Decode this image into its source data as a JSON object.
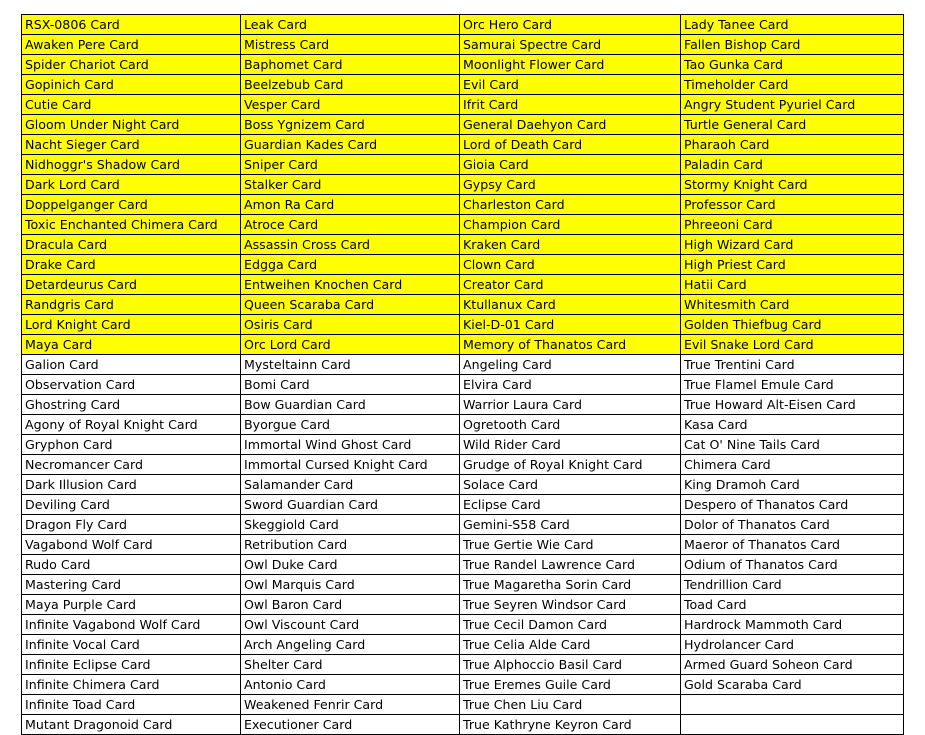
{
  "table": {
    "columns": 4,
    "highlight_color": "#ffff00",
    "plain_color": "#ffffff",
    "border_color": "#000000",
    "highlighted_row_count": 18,
    "rows": [
      {
        "highlighted": true,
        "cells": [
          "RSX-0806 Card",
          "Leak Card",
          "Orc Hero Card",
          "Lady Tanee Card"
        ]
      },
      {
        "highlighted": true,
        "cells": [
          "Awaken Pere Card",
          "Mistress Card",
          "Samurai Spectre Card",
          "Fallen Bishop Card"
        ]
      },
      {
        "highlighted": true,
        "cells": [
          "Spider Chariot Card",
          "Baphomet Card",
          "Moonlight Flower Card",
          "Tao Gunka Card"
        ]
      },
      {
        "highlighted": true,
        "cells": [
          "Gopinich Card",
          "Beelzebub Card",
          "Evil Card",
          "Timeholder Card"
        ]
      },
      {
        "highlighted": true,
        "cells": [
          "Cutie Card",
          "Vesper Card",
          "Ifrit Card",
          "Angry Student Pyuriel Card"
        ]
      },
      {
        "highlighted": true,
        "cells": [
          "Gloom Under Night Card",
          "Boss Ygnizem Card",
          "General Daehyon Card",
          "Turtle General Card"
        ]
      },
      {
        "highlighted": true,
        "cells": [
          "Nacht Sieger Card",
          "Guardian Kades Card",
          "Lord of Death Card",
          "Pharaoh Card"
        ]
      },
      {
        "highlighted": true,
        "cells": [
          "Nidhoggr's Shadow Card",
          "Sniper Card",
          "Gioia Card",
          "Paladin Card"
        ]
      },
      {
        "highlighted": true,
        "cells": [
          "Dark Lord Card",
          "Stalker Card",
          "Gypsy Card",
          "Stormy Knight Card"
        ]
      },
      {
        "highlighted": true,
        "cells": [
          "Doppelganger Card",
          "Amon Ra Card",
          "Charleston Card",
          "Professor Card"
        ]
      },
      {
        "highlighted": true,
        "cells": [
          "Toxic Enchanted Chimera Card",
          "Atroce Card",
          "Champion Card",
          "Phreeoni Card"
        ]
      },
      {
        "highlighted": true,
        "cells": [
          "Dracula Card",
          "Assassin Cross Card",
          "Kraken Card",
          "High Wizard Card"
        ]
      },
      {
        "highlighted": true,
        "cells": [
          "Drake Card",
          "Edgga Card",
          "Clown Card",
          "High Priest Card"
        ]
      },
      {
        "highlighted": true,
        "cells": [
          "Detardeurus Card",
          "Entweihen Knochen Card",
          "Creator Card",
          "Hatii Card"
        ]
      },
      {
        "highlighted": true,
        "cells": [
          "Randgris Card",
          "Queen Scaraba Card",
          "Ktullanux Card",
          "Whitesmith Card"
        ]
      },
      {
        "highlighted": true,
        "cells": [
          "Lord Knight Card",
          "Osiris Card",
          "Kiel-D-01 Card",
          "Golden Thiefbug Card"
        ]
      },
      {
        "highlighted": true,
        "cells": [
          "Maya Card",
          "Orc Lord Card",
          "Memory of Thanatos Card",
          "Evil Snake Lord Card"
        ]
      },
      {
        "highlighted": false,
        "cells": [
          "Galion Card",
          "Mysteltainn Card",
          "Angeling Card",
          "True Trentini Card"
        ]
      },
      {
        "highlighted": false,
        "cells": [
          "Observation Card",
          "Bomi Card",
          "Elvira Card",
          "True Flamel Emule Card"
        ]
      },
      {
        "highlighted": false,
        "cells": [
          "Ghostring Card",
          "Bow Guardian Card",
          "Warrior Laura Card",
          "True Howard Alt-Eisen Card"
        ]
      },
      {
        "highlighted": false,
        "cells": [
          "Agony of Royal Knight Card",
          "Byorgue Card",
          "Ogretooth Card",
          "Kasa Card"
        ]
      },
      {
        "highlighted": false,
        "cells": [
          "Gryphon Card",
          "Immortal Wind Ghost Card",
          "Wild Rider Card",
          "Cat O' Nine Tails Card"
        ]
      },
      {
        "highlighted": false,
        "cells": [
          "Necromancer Card",
          "Immortal Cursed Knight Card",
          "Grudge of Royal Knight Card",
          "Chimera Card"
        ]
      },
      {
        "highlighted": false,
        "cells": [
          "Dark Illusion Card",
          "Salamander Card",
          "Solace Card",
          "King Dramoh Card"
        ]
      },
      {
        "highlighted": false,
        "cells": [
          "Deviling Card",
          "Sword Guardian Card",
          "Eclipse Card",
          "Despero of Thanatos Card"
        ]
      },
      {
        "highlighted": false,
        "cells": [
          "Dragon Fly Card",
          "Skeggiold Card",
          "Gemini-S58 Card",
          "Dolor of Thanatos Card"
        ]
      },
      {
        "highlighted": false,
        "cells": [
          "Vagabond Wolf Card",
          "Retribution Card",
          "True Gertie Wie Card",
          "Maeror of Thanatos Card"
        ]
      },
      {
        "highlighted": false,
        "cells": [
          "Rudo Card",
          "Owl Duke Card",
          "True Randel Lawrence Card",
          "Odium of Thanatos Card"
        ]
      },
      {
        "highlighted": false,
        "cells": [
          "Mastering Card",
          "Owl Marquis Card",
          "True Magaretha Sorin Card",
          "Tendrillion Card"
        ]
      },
      {
        "highlighted": false,
        "cells": [
          "Maya Purple Card",
          "Owl Baron Card",
          "True Seyren Windsor Card",
          "Toad Card"
        ]
      },
      {
        "highlighted": false,
        "cells": [
          "Infinite Vagabond Wolf Card",
          "Owl Viscount Card",
          "True Cecil Damon Card",
          "Hardrock Mammoth Card"
        ]
      },
      {
        "highlighted": false,
        "cells": [
          "Infinite Vocal Card",
          "Arch Angeling Card",
          "True Celia Alde Card",
          "Hydrolancer Card"
        ]
      },
      {
        "highlighted": false,
        "cells": [
          "Infinite Eclipse Card",
          "Shelter Card",
          "True Alphoccio Basil Card",
          "Armed Guard Soheon Card"
        ]
      },
      {
        "highlighted": false,
        "cells": [
          "Infinite Chimera Card",
          "Antonio Card",
          "True Eremes Guile Card",
          "Gold Scaraba Card"
        ]
      },
      {
        "highlighted": false,
        "cells": [
          "Infinite Toad Card",
          "Weakened Fenrir Card",
          "True Chen Liu Card",
          ""
        ]
      },
      {
        "highlighted": false,
        "cells": [
          "Mutant Dragonoid Card",
          "Executioner Card",
          "True Kathryne Keyron Card",
          ""
        ]
      }
    ]
  }
}
